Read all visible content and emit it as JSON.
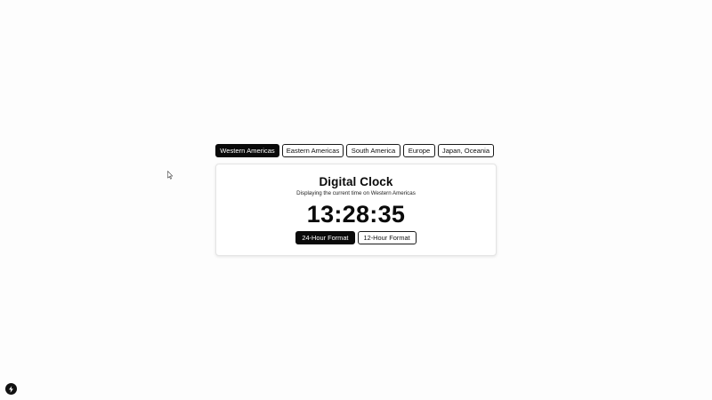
{
  "region_tabs": [
    {
      "label": "Western Americas",
      "active": true
    },
    {
      "label": "Eastern Americas",
      "active": false
    },
    {
      "label": "South America",
      "active": false
    },
    {
      "label": "Europe",
      "active": false
    },
    {
      "label": "Japan, Oceania",
      "active": false
    }
  ],
  "clock": {
    "title": "Digital Clock",
    "subtitle": "Displaying the current time on Western Americas",
    "time": "13:28:35"
  },
  "format_buttons": [
    {
      "label": "24-Hour Format",
      "active": true
    },
    {
      "label": "12-Hour Format",
      "active": false
    }
  ],
  "colors": {
    "accent": "#0a0a0a",
    "background": "#fdfdfd",
    "card": "#ffffff"
  },
  "icons": {
    "corner_button": "lightning-icon",
    "pointer": "mouse-cursor-icon"
  }
}
